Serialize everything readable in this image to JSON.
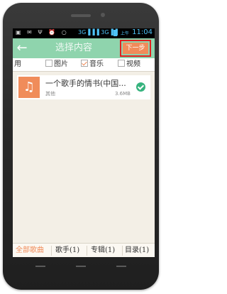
{
  "status_bar": {
    "left_icons": "▣ ✉ Ψ ⏰ ○",
    "signal_text": "3G▐▐▐ 3G▐▐",
    "ampm": "上午",
    "time": "11:04"
  },
  "title_bar": {
    "back_icon": "←",
    "title": "选择内容",
    "next_label": "下一步"
  },
  "tabs": [
    {
      "label": "用",
      "checked": false
    },
    {
      "label": "图片",
      "checked": false
    },
    {
      "label": "音乐",
      "checked": true
    },
    {
      "label": "视频",
      "checked": false
    }
  ],
  "song": {
    "icon": "♫",
    "title": "一个歌手的情书(中国...",
    "artist": "其他",
    "size": "3.6MB",
    "selected": true
  },
  "bottom_tabs": [
    {
      "label": "全部歌曲",
      "active": true
    },
    {
      "label": "歌手(1)",
      "active": false
    },
    {
      "label": "专辑(1)",
      "active": false
    },
    {
      "label": "目录(1)",
      "active": false
    }
  ],
  "colors": {
    "accent": "#8fd4ad",
    "next_button": "#f08c5a",
    "highlight_border": "#e02020",
    "check_green": "#36b37e"
  }
}
